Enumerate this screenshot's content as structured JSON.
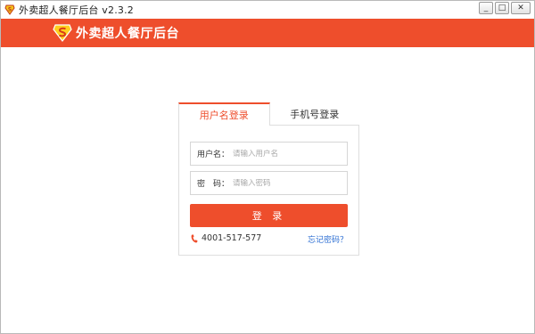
{
  "window": {
    "title": "外卖超人餐厅后台 v2.3.2",
    "controls": {
      "minimize": "_",
      "maximize": "□",
      "close": "✕"
    }
  },
  "header": {
    "brand": "外卖超人餐厅后台",
    "logo_icon": "superman-s-logo-icon"
  },
  "login": {
    "tabs": [
      {
        "label": "用户名登录",
        "active": true
      },
      {
        "label": "手机号登录",
        "active": false
      }
    ],
    "username": {
      "label": "用户名：",
      "placeholder": "请输入用户名",
      "value": ""
    },
    "password": {
      "label": "密　码：",
      "placeholder": "请输入密码",
      "value": ""
    },
    "submit_label": "登 录",
    "phone": "4001-517-577",
    "forgot_label": "忘记密码？"
  },
  "colors": {
    "accent": "#ee4e2c",
    "link": "#2d6fd3",
    "border": "#dedede"
  }
}
